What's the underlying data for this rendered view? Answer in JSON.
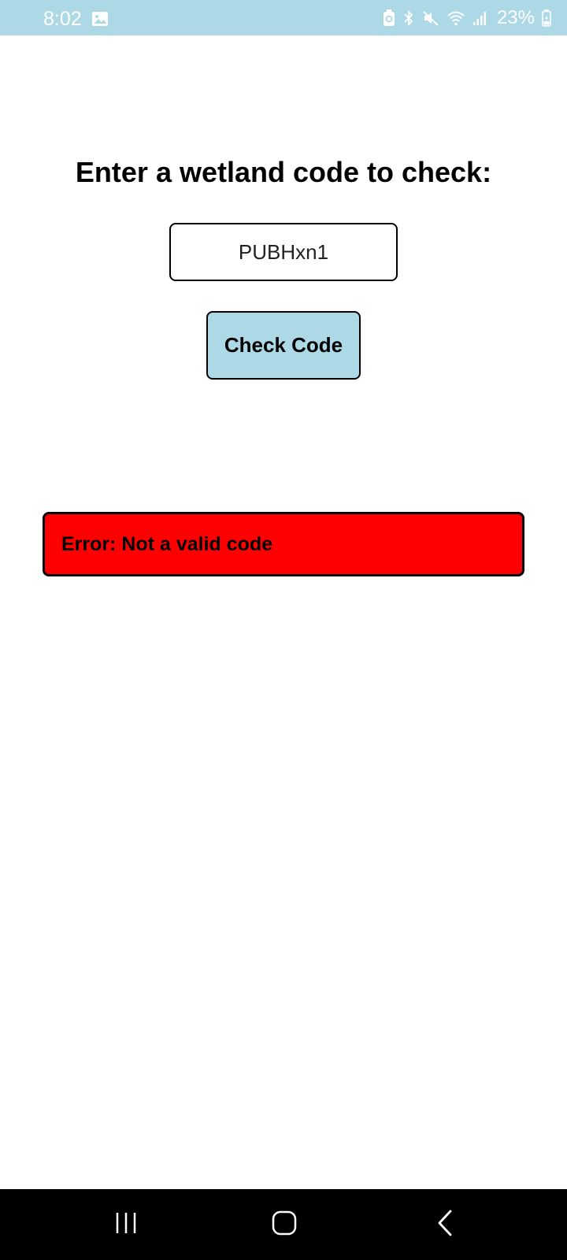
{
  "status_bar": {
    "time": "8:02",
    "battery_percent": "23%",
    "background_color": "#add8e6",
    "icons": [
      "gallery-icon",
      "battery-saver-icon",
      "bluetooth-icon",
      "mute-icon",
      "wifi-icon",
      "signal-icon",
      "battery-icon"
    ]
  },
  "main": {
    "heading": "Enter a wetland code to check:",
    "input_value": "PUBHxn1",
    "button_label": "Check Code",
    "button_color": "#add8e6",
    "error_message": "Error: Not a valid code",
    "error_color": "#ff0000"
  },
  "nav_bar": {
    "icons": [
      "recents-icon",
      "home-icon",
      "back-icon"
    ]
  }
}
